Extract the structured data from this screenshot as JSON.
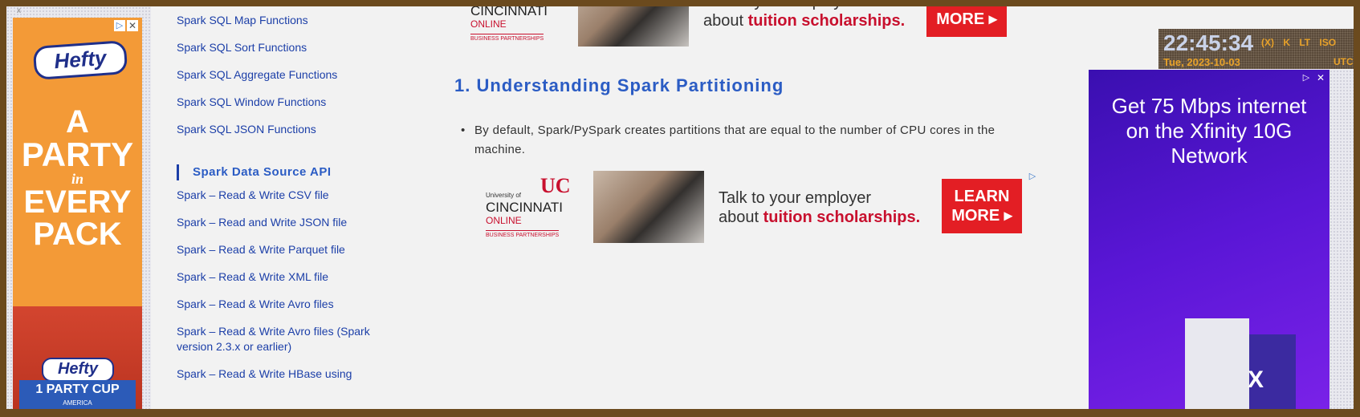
{
  "left_ad": {
    "brand": "Hefty",
    "tagline": [
      "A",
      "PARTY",
      "in",
      "EVERY",
      "PACK"
    ],
    "cup_brand": "Hefty",
    "cup_label": "1 PARTY CUP",
    "cup_sub": "AMERICA",
    "adchoice": "▷",
    "close": "✕",
    "tiny_close": "x"
  },
  "sidebar": {
    "links_top": [
      "Spark SQL Map Functions",
      "Spark SQL Sort Functions",
      "Spark SQL Aggregate Functions",
      "Spark SQL Window Functions",
      "Spark SQL JSON Functions"
    ],
    "heading": "Spark Data Source API",
    "links_bottom": [
      "Spark – Read & Write CSV file",
      "Spark – Read and Write JSON file",
      "Spark – Read & Write Parquet file",
      "Spark – Read & Write XML file",
      "Spark – Read & Write Avro files",
      "Spark – Read & Write Avro files (Spark version 2.3.x or earlier)",
      "Spark – Read & Write HBase using"
    ]
  },
  "uc_ad": {
    "univ": "University of",
    "mark": "UC",
    "cincinnati": "CINCINNATI",
    "online": "ONLINE",
    "partnerships": "BUSINESS PARTNERSHIPS",
    "line1": "Talk to your employer",
    "line2_prefix": "about ",
    "line2_bold": "tuition scholarships.",
    "button_line1": "LEARN",
    "button_line2": "MORE ▸",
    "adchoice": "▷"
  },
  "content": {
    "section_title": "1. Understanding Spark Partitioning",
    "bullet": "By default, Spark/PySpark creates partitions that are equal to the number of CPU cores in the machine."
  },
  "clock": {
    "time": "22:45:34",
    "tags": "(X) K LT ISO",
    "date": "Tue, 2023-10-03",
    "utc": "UTC"
  },
  "right_ad": {
    "headline": "Get 75 Mbps internet on the Xfinity 10G Network",
    "box_mark": "X",
    "adchoice": "▷",
    "close": "✕"
  },
  "colors": {
    "link": "#1c3fa8",
    "heading": "#2b5cc4",
    "frame": "#6b4a1e",
    "hefty_orange": "#f39a37",
    "xfinity_purple": "#5a16d6",
    "uc_red": "#c8102e"
  }
}
